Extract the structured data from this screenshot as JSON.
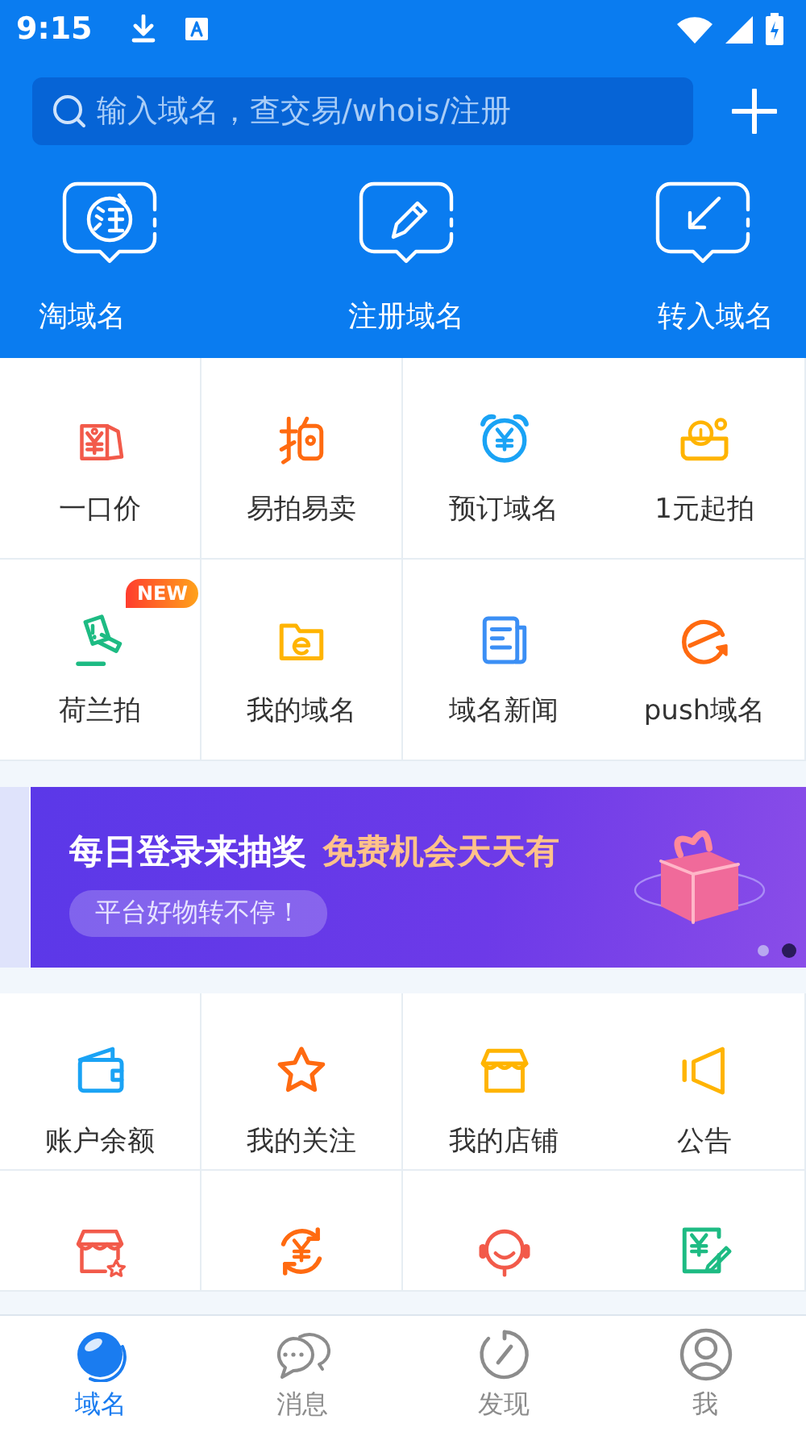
{
  "status_bar": {
    "time": "9:15"
  },
  "search": {
    "placeholder": "输入域名，查交易/whois/注册"
  },
  "quick_actions": [
    {
      "label": "淘域名"
    },
    {
      "label": "注册域名"
    },
    {
      "label": "转入域名"
    }
  ],
  "services": [
    {
      "label": "一口价"
    },
    {
      "label": "易拍易卖"
    },
    {
      "label": "预订域名"
    },
    {
      "label": "1元起拍"
    },
    {
      "label": "荷兰拍",
      "badge": "NEW"
    },
    {
      "label": "我的域名"
    },
    {
      "label": "域名新闻"
    },
    {
      "label": "push域名"
    }
  ],
  "banner": {
    "headline": "每日登录来抽奖",
    "highlight": "免费机会天天有",
    "slogan": "平台好物转不停！",
    "dots": [
      {
        "selected": false
      },
      {
        "selected": true
      }
    ]
  },
  "account": [
    {
      "label": "账户余额"
    },
    {
      "label": "我的关注"
    },
    {
      "label": "我的店铺"
    },
    {
      "label": "公告"
    }
  ],
  "tab_bar": [
    {
      "label": "域名",
      "selected": true
    },
    {
      "label": "消息",
      "selected": false
    },
    {
      "label": "发现",
      "selected": false
    },
    {
      "label": "我",
      "selected": false
    }
  ]
}
